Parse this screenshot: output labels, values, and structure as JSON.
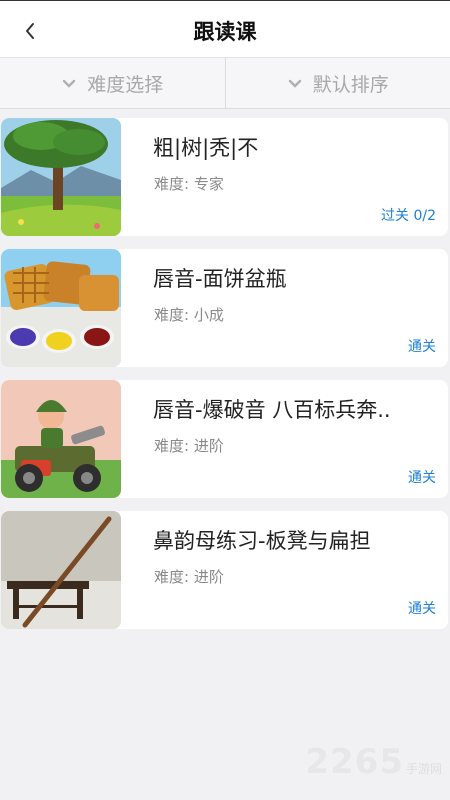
{
  "header": {
    "title": "跟读课"
  },
  "filters": [
    {
      "label": "难度选择"
    },
    {
      "label": "默认排序"
    }
  ],
  "courses": [
    {
      "title": "粗|树|秃|不",
      "difficulty": "难度: 专家",
      "status": "过关 0/2",
      "image": "tree-landscape"
    },
    {
      "title": "唇音-面饼盆瓶",
      "difficulty": "难度: 小成",
      "status": "通关",
      "image": "waffles-paints"
    },
    {
      "title": "唇音-爆破音 八百标兵奔..",
      "difficulty": "难度: 进阶",
      "status": "通关",
      "image": "soldier-jeep"
    },
    {
      "title": "鼻韵母练习-板凳与扁担",
      "difficulty": "难度: 进阶",
      "status": "通关",
      "image": "bench-pole"
    }
  ],
  "watermark": {
    "number": "2265",
    "text": "手游网"
  },
  "colors": {
    "accent": "#1e7fd6",
    "background": "#f1f1f3"
  }
}
